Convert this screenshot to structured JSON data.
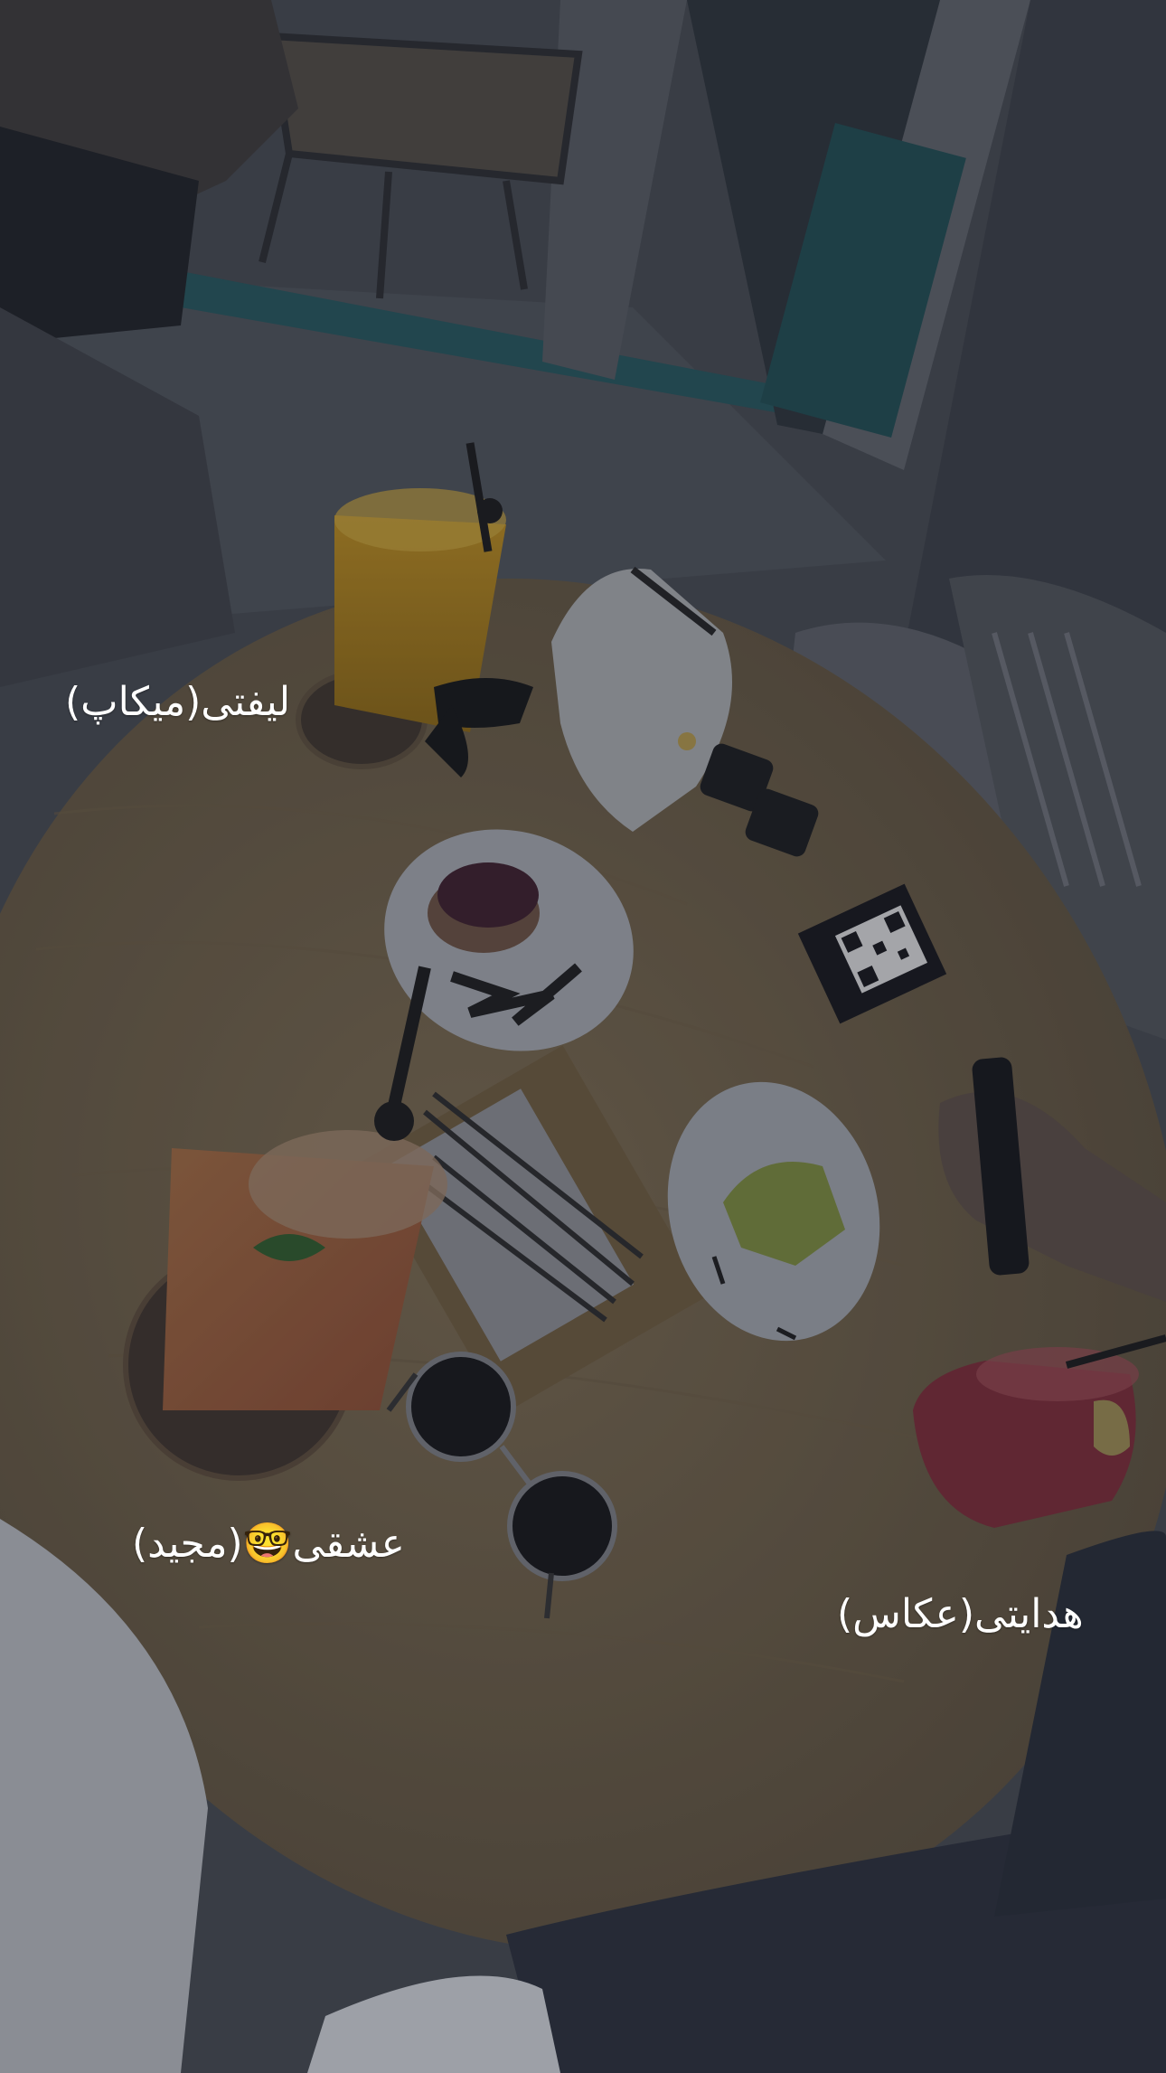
{
  "story": {
    "captions": [
      {
        "text": "لیفتی(میکاپ)"
      },
      {
        "text": "عشقی🤓(مجید)"
      },
      {
        "text": "هدایتی(عکاس)"
      }
    ]
  },
  "colors": {
    "table": "#6e6048",
    "floor": "#4a4f55",
    "teal_trim": "#24555a",
    "overlay": "#1c2230"
  },
  "objects": [
    "orange-juice-glass",
    "mojito-glass",
    "red-smoothie-glass",
    "white-handbag",
    "cheesecake-plate",
    "pistachio-cake-plate",
    "cutlery-tray",
    "round-sunglasses",
    "black-sunglasses",
    "qr-code-stand",
    "phone-in-hand"
  ]
}
